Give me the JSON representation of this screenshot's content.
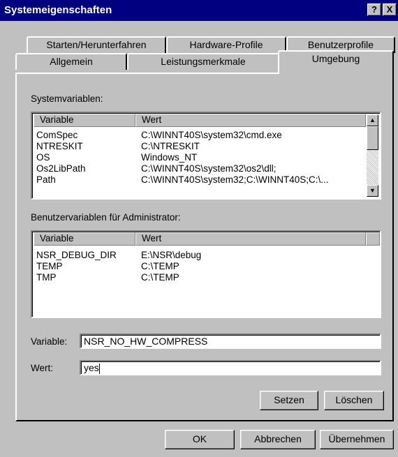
{
  "window": {
    "title": "Systemeigenschaften",
    "help_label": "?",
    "close_label": "X"
  },
  "tabs": {
    "row1": [
      "Starten/Herunterfahren",
      "Hardware-Profile",
      "Benutzerprofile"
    ],
    "row2": [
      "Allgemein",
      "Leistungsmerkmale",
      "Umgebung"
    ],
    "active": "Umgebung"
  },
  "system_vars": {
    "label": "Systemvariablen:",
    "col_variable": "Variable",
    "col_value": "Wert",
    "rows": [
      {
        "name": "ComSpec",
        "value": "C:\\WINNT40S\\system32\\cmd.exe"
      },
      {
        "name": "NTRESKIT",
        "value": "C:\\NTRESKIT"
      },
      {
        "name": "OS",
        "value": "Windows_NT"
      },
      {
        "name": "Os2LibPath",
        "value": "C:\\WINNT40S\\system32\\os2\\dll;"
      },
      {
        "name": "Path",
        "value": "C:\\WINNT40S\\system32;C:\\WINNT40S;C:\\..."
      }
    ]
  },
  "user_vars": {
    "label": "Benutzervariablen für Administrator:",
    "col_variable": "Variable",
    "col_value": "Wert",
    "rows": [
      {
        "name": "NSR_DEBUG_DIR",
        "value": "E:\\NSR\\debug"
      },
      {
        "name": "TEMP",
        "value": "C:\\TEMP"
      },
      {
        "name": "TMP",
        "value": "C:\\TEMP"
      }
    ]
  },
  "edit": {
    "variable_label": "Variable:",
    "variable_value": "NSR_NO_HW_COMPRESS",
    "value_label": "Wert:",
    "value_value": "yes"
  },
  "buttons": {
    "set": "Setzen",
    "delete": "Löschen",
    "ok": "OK",
    "cancel": "Abbrechen",
    "apply": "Übernehmen"
  }
}
